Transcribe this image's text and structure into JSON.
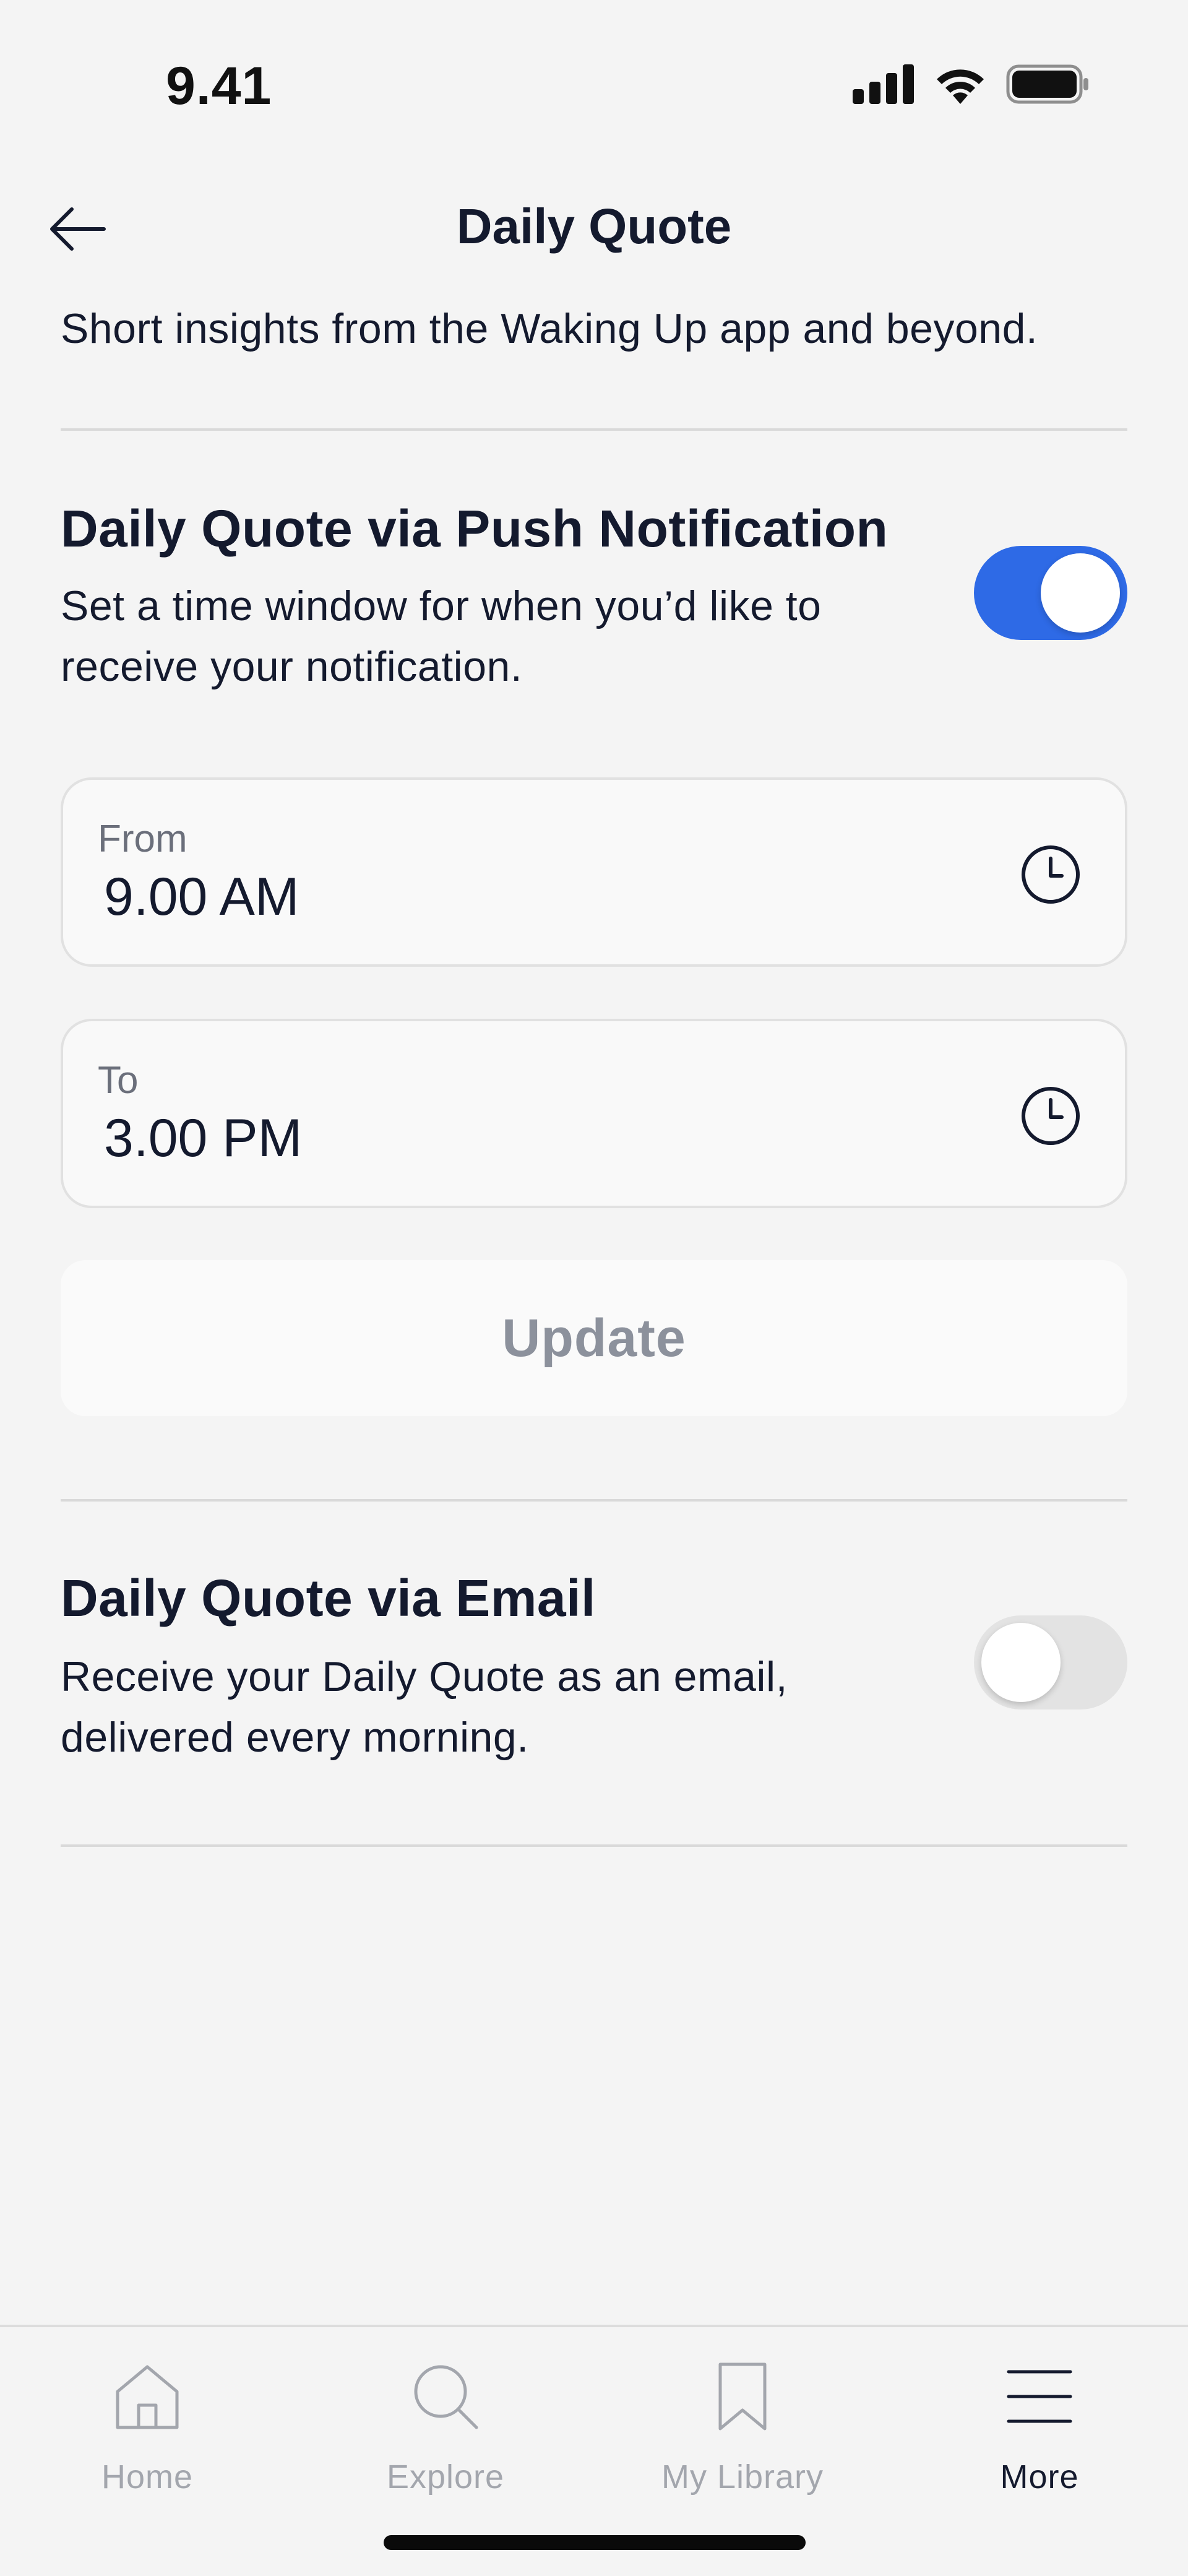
{
  "status_bar": {
    "time": "9.41"
  },
  "header": {
    "title": "Daily Quote",
    "subtitle": "Short insights from the Waking Up app and beyond."
  },
  "push_section": {
    "title": "Daily Quote via Push Notification",
    "description": "Set a time window for when you’d like to receive your notification.",
    "enabled": true,
    "from_label": "From",
    "from_value": "9.00 AM",
    "to_label": "To",
    "to_value": "3.00 PM",
    "update_label": "Update"
  },
  "email_section": {
    "title": "Daily Quote via Email",
    "description": "Receive your Daily Quote as an email, delivered every morning.",
    "enabled": false
  },
  "tabbar": {
    "items": [
      {
        "label": "Home",
        "icon": "home-icon",
        "active": false
      },
      {
        "label": "Explore",
        "icon": "search-icon",
        "active": false
      },
      {
        "label": "My Library",
        "icon": "bookmark-icon",
        "active": false
      },
      {
        "label": "More",
        "icon": "menu-icon",
        "active": true
      }
    ]
  },
  "colors": {
    "accent": "#2e6ae6",
    "text": "#141a2e",
    "muted": "#a3a6ad"
  }
}
